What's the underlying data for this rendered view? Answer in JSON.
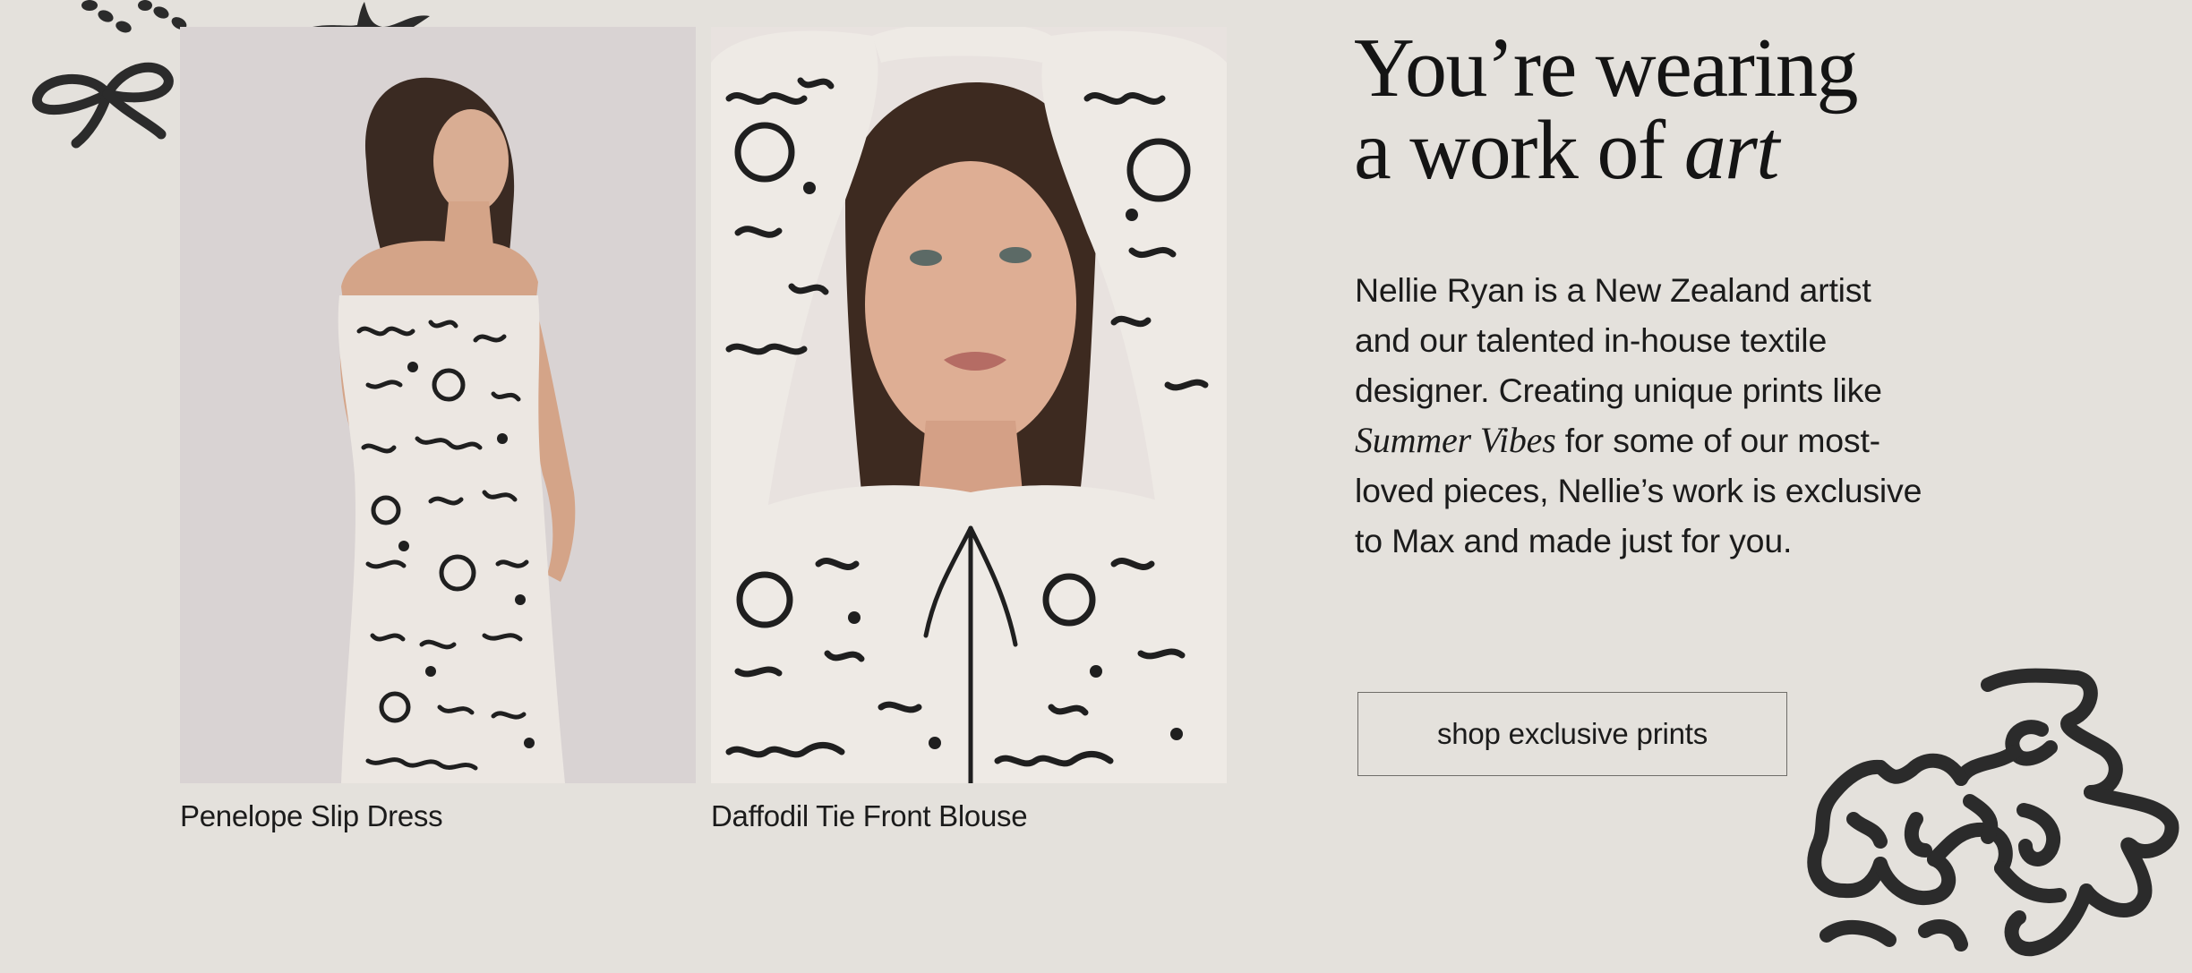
{
  "headline": {
    "line1": "You’re wearing",
    "line2_prefix": "a work of ",
    "line2_italic": "art"
  },
  "body": {
    "text_before": "Nellie Ryan is a New Zealand artist and our talented in-house textile designer. Creating unique prints like ",
    "italic": "Summer Vibes",
    "text_after": " for some of our most-loved pieces, Nellie’s work is exclusive to Max and made just for you."
  },
  "cta": {
    "label": "shop exclusive prints"
  },
  "products": [
    {
      "name": "Penelope Slip Dress"
    },
    {
      "name": "Daffodil Tie Front Blouse"
    }
  ],
  "colors": {
    "background": "#e4e1dc",
    "text": "#1b1b1b",
    "ink": "#2b2b2b",
    "button_border": "#6f6d69"
  },
  "icons": [
    "bead-garland-icon",
    "bow-icon",
    "starfish-icon",
    "flower-squiggle-icon"
  ]
}
